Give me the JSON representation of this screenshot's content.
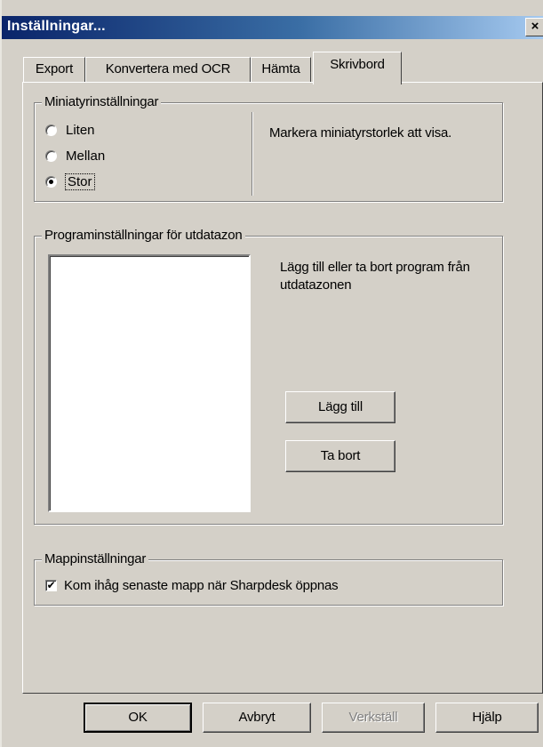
{
  "window": {
    "title": "Inställningar...",
    "close_glyph": "×"
  },
  "tabs": [
    {
      "label": "Export",
      "active": false
    },
    {
      "label": "Konvertera med OCR",
      "active": false
    },
    {
      "label": "Hämta",
      "active": false
    },
    {
      "label": "Skrivbord",
      "active": true
    }
  ],
  "thumbnails": {
    "legend": "Miniatyrinställningar",
    "options": [
      {
        "label": "Liten",
        "selected": false
      },
      {
        "label": "Mellan",
        "selected": false
      },
      {
        "label": "Stor",
        "selected": true
      }
    ],
    "description": "Markera miniatyrstorlek att visa."
  },
  "output_tray": {
    "legend": "Programinställningar för utdatazon",
    "description": "Lägg till eller ta bort program från utdatazonen",
    "add_label": "Lägg till",
    "remove_label": "Ta bort",
    "program_list": []
  },
  "folder": {
    "legend": "Mappinställningar",
    "remember_label": "Kom ihåg senaste mapp när Sharpdesk öppnas",
    "remember_checked": true,
    "check_glyph": "✔"
  },
  "footer": {
    "ok_label": "OK",
    "cancel_label": "Avbryt",
    "apply_label": "Verkställ",
    "help_label": "Hjälp"
  }
}
